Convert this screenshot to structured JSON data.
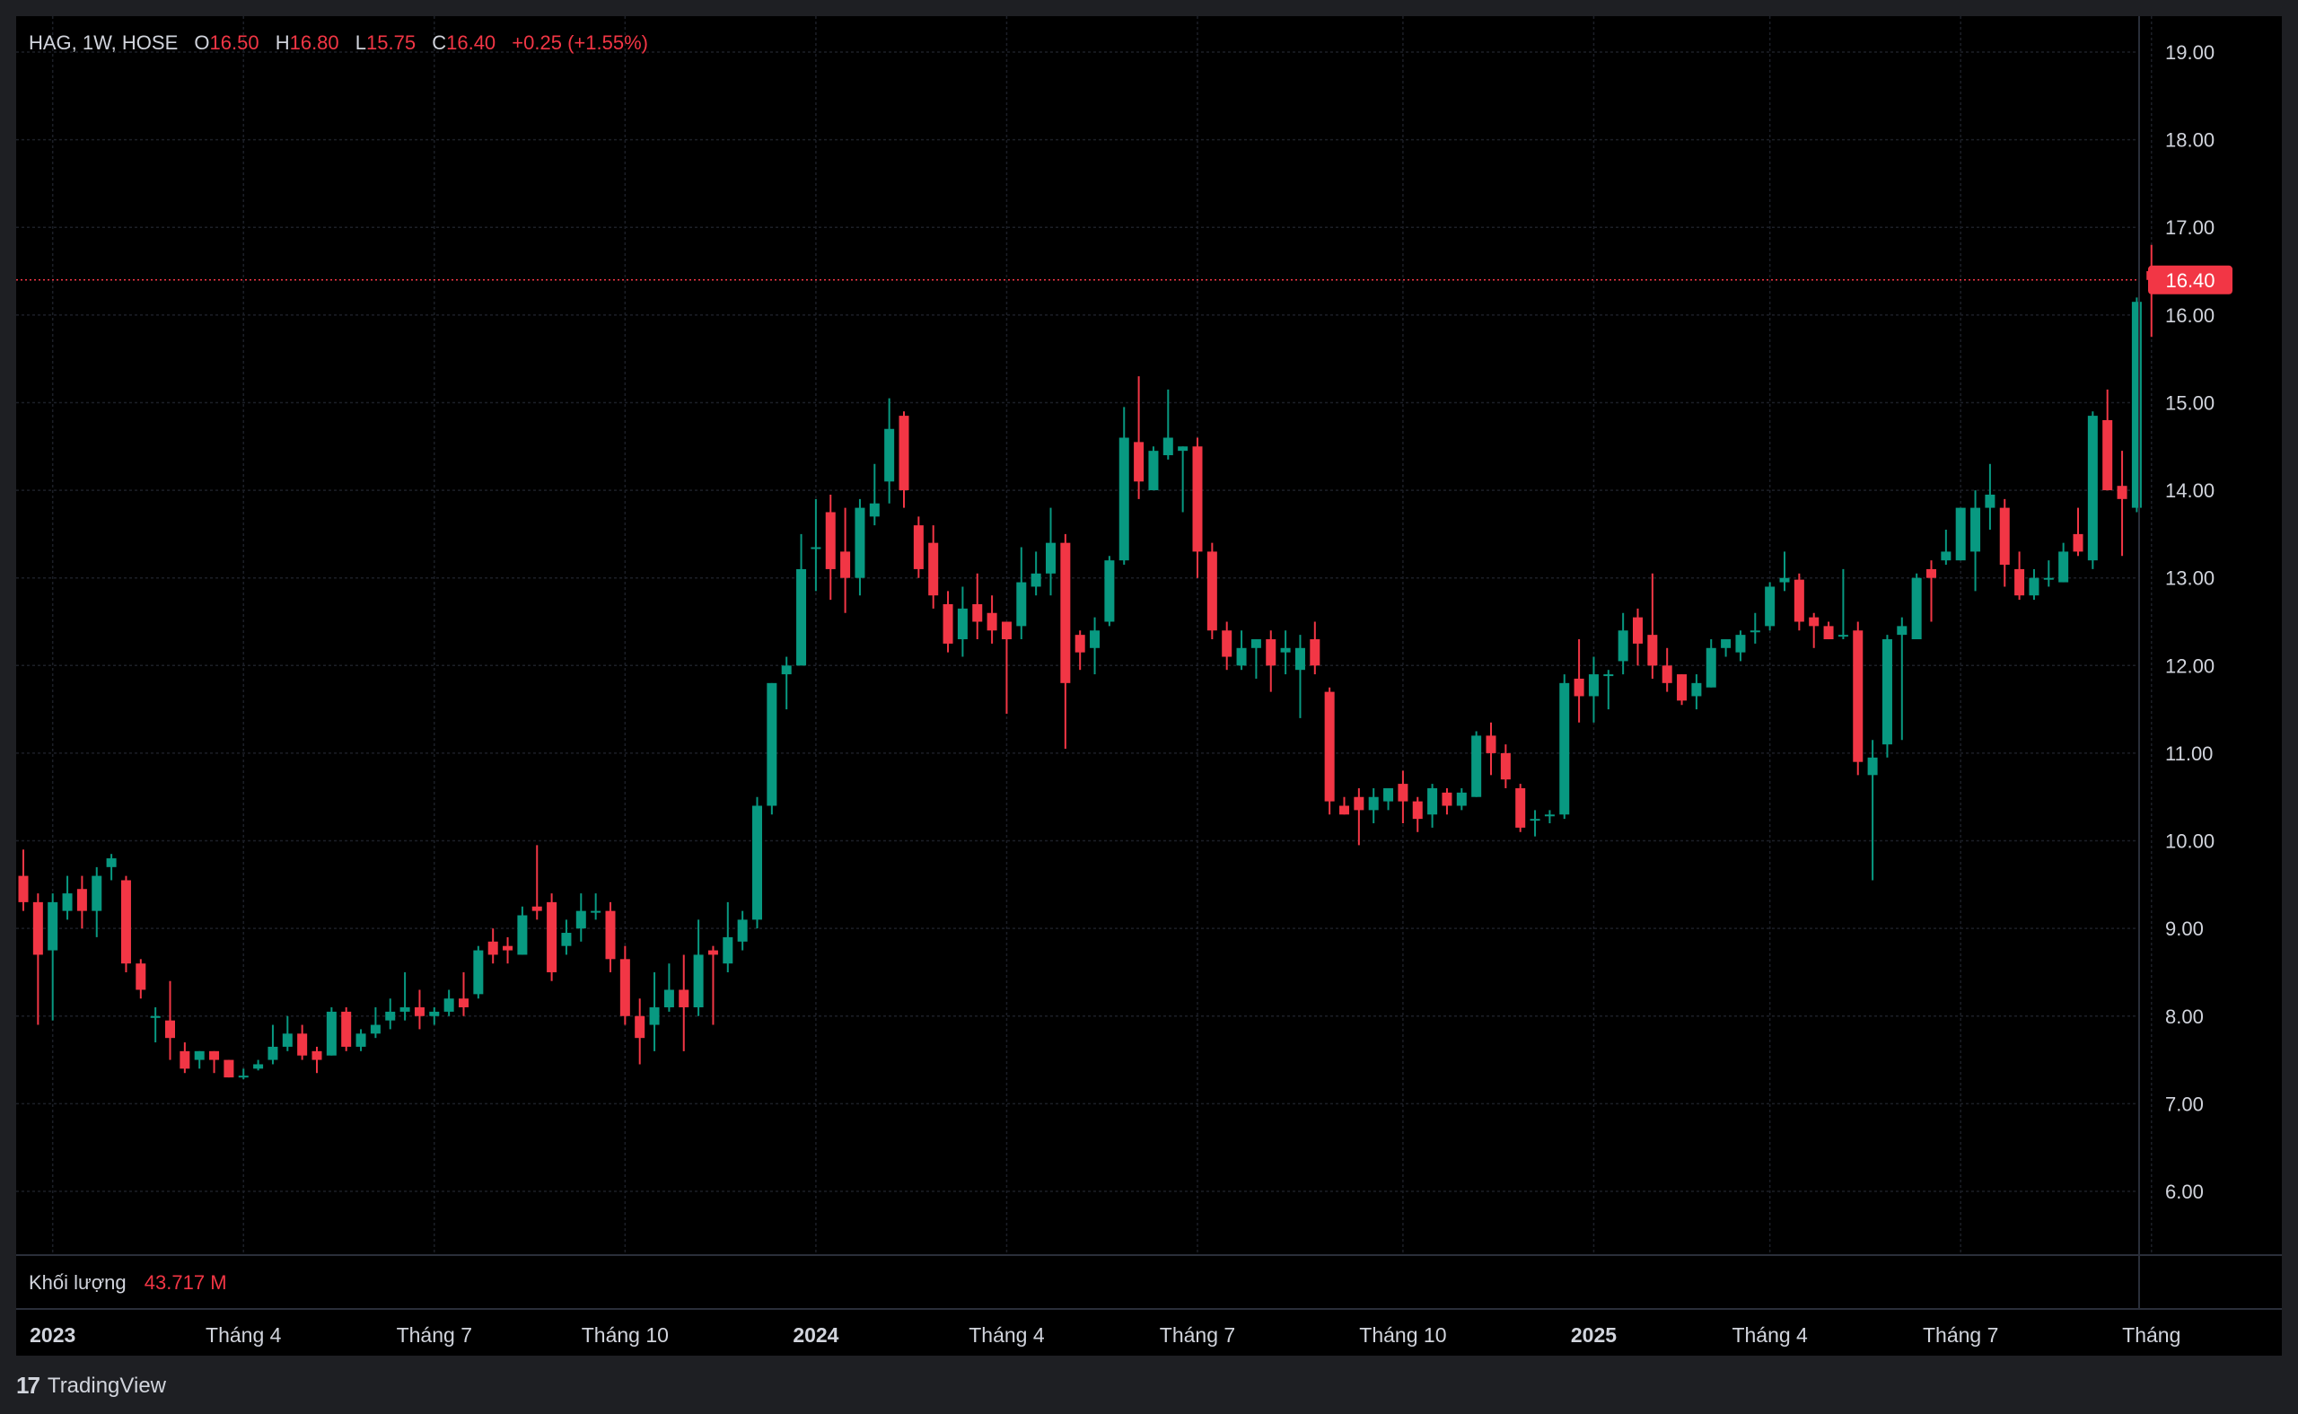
{
  "legend": {
    "symbol": "HAG, 1W, HOSE",
    "o_label": "O",
    "o_value": "16.50",
    "h_label": "H",
    "h_value": "16.80",
    "l_label": "L",
    "l_value": "15.75",
    "c_label": "C",
    "c_value": "16.40",
    "change": "+0.25 (+1.55%)"
  },
  "volume_legend": {
    "label": "Khối lượng",
    "value": "43.717 M"
  },
  "last_price_label": "16.40",
  "brand": {
    "logo": "17",
    "name": "TradingView"
  },
  "colors": {
    "up": "#089981",
    "down": "#f23645",
    "background": "#000000",
    "frame": "#1e1f23",
    "text": "#d1d4dc",
    "grid": "#2a2e39"
  },
  "chart_data": {
    "type": "candlestick",
    "interval": "1W",
    "ylim": [
      5.3,
      19.4
    ],
    "yticks": [
      "19.00",
      "18.00",
      "17.00",
      "16.00",
      "15.00",
      "14.00",
      "13.00",
      "12.00",
      "11.00",
      "10.00",
      "9.00",
      "8.00",
      "7.00",
      "6.00"
    ],
    "xticks": [
      {
        "label": "2023",
        "bold": true,
        "week": 2
      },
      {
        "label": "Tháng 4",
        "bold": false,
        "week": 15
      },
      {
        "label": "Tháng 7",
        "bold": false,
        "week": 28
      },
      {
        "label": "Tháng 10",
        "bold": false,
        "week": 41
      },
      {
        "label": "2024",
        "bold": true,
        "week": 54
      },
      {
        "label": "Tháng 4",
        "bold": false,
        "week": 67
      },
      {
        "label": "Tháng 7",
        "bold": false,
        "week": 80
      },
      {
        "label": "Tháng 10",
        "bold": false,
        "week": 94
      },
      {
        "label": "2025",
        "bold": true,
        "week": 107
      },
      {
        "label": "Tháng 4",
        "bold": false,
        "week": 119
      },
      {
        "label": "Tháng 7",
        "bold": false,
        "week": 132
      },
      {
        "label": "Tháng",
        "bold": false,
        "week": 145
      }
    ],
    "last_price": 16.4,
    "candles": [
      [
        9.6,
        9.3,
        9.9,
        9.2
      ],
      [
        9.3,
        8.7,
        9.4,
        7.9
      ],
      [
        8.75,
        9.3,
        9.4,
        7.95
      ],
      [
        9.2,
        9.4,
        9.6,
        9.1
      ],
      [
        9.45,
        9.2,
        9.6,
        9.0
      ],
      [
        9.2,
        9.6,
        9.7,
        8.9
      ],
      [
        9.7,
        9.8,
        9.85,
        9.55
      ],
      [
        9.55,
        8.6,
        9.6,
        8.5
      ],
      [
        8.6,
        8.3,
        8.65,
        8.2
      ],
      [
        8.0,
        8.0,
        8.1,
        7.7
      ],
      [
        7.95,
        7.75,
        8.4,
        7.5
      ],
      [
        7.6,
        7.4,
        7.7,
        7.35
      ],
      [
        7.5,
        7.6,
        7.6,
        7.4
      ],
      [
        7.6,
        7.5,
        7.6,
        7.35
      ],
      [
        7.5,
        7.3,
        7.5,
        7.3
      ],
      [
        7.32,
        7.32,
        7.4,
        7.28
      ],
      [
        7.4,
        7.45,
        7.5,
        7.38
      ],
      [
        7.5,
        7.65,
        7.9,
        7.45
      ],
      [
        7.65,
        7.8,
        8.0,
        7.6
      ],
      [
        7.8,
        7.55,
        7.9,
        7.5
      ],
      [
        7.6,
        7.5,
        7.65,
        7.35
      ],
      [
        7.55,
        8.05,
        8.1,
        7.55
      ],
      [
        8.05,
        7.65,
        8.1,
        7.6
      ],
      [
        7.65,
        7.8,
        7.85,
        7.6
      ],
      [
        7.8,
        7.9,
        8.1,
        7.75
      ],
      [
        7.95,
        8.05,
        8.2,
        7.85
      ],
      [
        8.05,
        8.1,
        8.5,
        7.95
      ],
      [
        8.1,
        8.0,
        8.3,
        7.85
      ],
      [
        8.0,
        8.05,
        8.1,
        7.9
      ],
      [
        8.05,
        8.2,
        8.3,
        8.0
      ],
      [
        8.2,
        8.1,
        8.5,
        8.0
      ],
      [
        8.25,
        8.75,
        8.8,
        8.2
      ],
      [
        8.85,
        8.7,
        9.0,
        8.6
      ],
      [
        8.8,
        8.75,
        8.9,
        8.6
      ],
      [
        8.7,
        9.15,
        9.25,
        8.7
      ],
      [
        9.25,
        9.2,
        9.95,
        9.1
      ],
      [
        9.3,
        8.5,
        9.4,
        8.4
      ],
      [
        8.8,
        8.95,
        9.1,
        8.7
      ],
      [
        9.0,
        9.2,
        9.4,
        8.85
      ],
      [
        9.2,
        9.2,
        9.4,
        9.1
      ],
      [
        9.2,
        8.65,
        9.3,
        8.5
      ],
      [
        8.65,
        8.0,
        8.8,
        7.9
      ],
      [
        8.0,
        7.75,
        8.2,
        7.45
      ],
      [
        7.9,
        8.1,
        8.5,
        7.6
      ],
      [
        8.1,
        8.3,
        8.6,
        8.05
      ],
      [
        8.3,
        8.1,
        8.7,
        7.6
      ],
      [
        8.1,
        8.7,
        9.1,
        8.0
      ],
      [
        8.75,
        8.7,
        8.8,
        7.9
      ],
      [
        8.6,
        8.9,
        9.3,
        8.5
      ],
      [
        8.85,
        9.1,
        9.2,
        8.75
      ],
      [
        9.1,
        10.4,
        10.5,
        9.0
      ],
      [
        10.4,
        11.8,
        11.8,
        10.3
      ],
      [
        11.9,
        12.0,
        12.1,
        11.5
      ],
      [
        12.0,
        13.1,
        13.5,
        12.0
      ],
      [
        13.35,
        13.35,
        13.9,
        12.85
      ],
      [
        13.75,
        13.1,
        13.95,
        12.75
      ],
      [
        13.3,
        13.0,
        13.8,
        12.6
      ],
      [
        13.0,
        13.8,
        13.9,
        12.8
      ],
      [
        13.7,
        13.85,
        14.3,
        13.6
      ],
      [
        14.1,
        14.7,
        15.05,
        13.85
      ],
      [
        14.85,
        14.0,
        14.9,
        13.8
      ],
      [
        13.6,
        13.1,
        13.7,
        13.0
      ],
      [
        13.4,
        12.8,
        13.6,
        12.65
      ],
      [
        12.7,
        12.25,
        12.85,
        12.15
      ],
      [
        12.3,
        12.65,
        12.9,
        12.1
      ],
      [
        12.7,
        12.5,
        13.05,
        12.3
      ],
      [
        12.6,
        12.4,
        12.8,
        12.25
      ],
      [
        12.5,
        12.3,
        12.5,
        11.45
      ],
      [
        12.45,
        12.95,
        13.35,
        12.3
      ],
      [
        12.9,
        13.05,
        13.3,
        12.8
      ],
      [
        13.05,
        13.4,
        13.8,
        12.8
      ],
      [
        13.4,
        11.8,
        13.5,
        11.05
      ],
      [
        12.35,
        12.15,
        12.4,
        11.95
      ],
      [
        12.2,
        12.4,
        12.55,
        11.9
      ],
      [
        12.5,
        13.2,
        13.25,
        12.45
      ],
      [
        13.2,
        14.6,
        14.95,
        13.15
      ],
      [
        14.55,
        14.1,
        15.3,
        13.9
      ],
      [
        14.0,
        14.45,
        14.5,
        14.0
      ],
      [
        14.4,
        14.6,
        15.15,
        14.35
      ],
      [
        14.45,
        14.5,
        14.5,
        13.75
      ],
      [
        14.5,
        13.3,
        14.6,
        13.0
      ],
      [
        13.3,
        12.4,
        13.4,
        12.3
      ],
      [
        12.4,
        12.1,
        12.5,
        11.95
      ],
      [
        12.0,
        12.2,
        12.4,
        11.95
      ],
      [
        12.2,
        12.3,
        12.3,
        11.85
      ],
      [
        12.3,
        12.0,
        12.4,
        11.7
      ],
      [
        12.15,
        12.2,
        12.4,
        11.9
      ],
      [
        11.95,
        12.2,
        12.35,
        11.4
      ],
      [
        12.3,
        12.0,
        12.5,
        11.9
      ],
      [
        11.7,
        10.45,
        11.75,
        10.3
      ],
      [
        10.4,
        10.3,
        10.5,
        10.3
      ],
      [
        10.5,
        10.35,
        10.6,
        9.95
      ],
      [
        10.35,
        10.5,
        10.6,
        10.2
      ],
      [
        10.45,
        10.6,
        10.55,
        10.35
      ],
      [
        10.65,
        10.45,
        10.8,
        10.2
      ],
      [
        10.45,
        10.25,
        10.5,
        10.1
      ],
      [
        10.3,
        10.6,
        10.65,
        10.15
      ],
      [
        10.55,
        10.4,
        10.6,
        10.3
      ],
      [
        10.4,
        10.55,
        10.6,
        10.35
      ],
      [
        10.5,
        11.2,
        11.25,
        10.5
      ],
      [
        11.2,
        11.0,
        11.35,
        10.75
      ],
      [
        11.0,
        10.7,
        11.1,
        10.6
      ],
      [
        10.6,
        10.15,
        10.65,
        10.1
      ],
      [
        10.25,
        10.25,
        10.35,
        10.05
      ],
      [
        10.3,
        10.3,
        10.35,
        10.2
      ],
      [
        10.3,
        11.8,
        11.9,
        10.25
      ],
      [
        11.85,
        11.65,
        12.3,
        11.35
      ],
      [
        11.65,
        11.9,
        12.1,
        11.35
      ],
      [
        11.9,
        11.9,
        11.95,
        11.5
      ],
      [
        12.05,
        12.4,
        12.6,
        11.9
      ],
      [
        12.55,
        12.25,
        12.65,
        12.0
      ],
      [
        12.35,
        12.0,
        13.05,
        11.85
      ],
      [
        12.0,
        11.8,
        12.2,
        11.7
      ],
      [
        11.9,
        11.6,
        11.9,
        11.55
      ],
      [
        11.65,
        11.8,
        11.9,
        11.5
      ],
      [
        11.75,
        12.2,
        12.3,
        11.75
      ],
      [
        12.2,
        12.3,
        12.3,
        12.1
      ],
      [
        12.15,
        12.35,
        12.4,
        12.05
      ],
      [
        12.4,
        12.4,
        12.6,
        12.25
      ],
      [
        12.45,
        12.9,
        12.95,
        12.4
      ],
      [
        12.95,
        13.0,
        13.3,
        12.85
      ],
      [
        12.98,
        12.5,
        13.05,
        12.4
      ],
      [
        12.55,
        12.45,
        12.6,
        12.2
      ],
      [
        12.45,
        12.3,
        12.5,
        12.3
      ],
      [
        12.35,
        12.35,
        13.1,
        12.3
      ],
      [
        12.4,
        10.9,
        12.5,
        10.75
      ],
      [
        10.75,
        10.95,
        11.15,
        9.55
      ],
      [
        11.1,
        12.3,
        12.35,
        10.95
      ],
      [
        12.35,
        12.45,
        12.55,
        11.15
      ],
      [
        12.3,
        13.0,
        13.05,
        12.3
      ],
      [
        13.1,
        13.0,
        13.2,
        12.5
      ],
      [
        13.2,
        13.3,
        13.55,
        13.15
      ],
      [
        13.2,
        13.8,
        13.8,
        13.2
      ],
      [
        13.3,
        13.8,
        14.0,
        12.85
      ],
      [
        13.8,
        13.95,
        14.3,
        13.55
      ],
      [
        13.8,
        13.15,
        13.9,
        12.9
      ],
      [
        13.1,
        12.8,
        13.3,
        12.75
      ],
      [
        12.8,
        13.0,
        13.1,
        12.75
      ],
      [
        13.0,
        13.0,
        13.2,
        12.9
      ],
      [
        12.95,
        13.3,
        13.4,
        12.95
      ],
      [
        13.5,
        13.3,
        13.8,
        13.25
      ],
      [
        13.2,
        14.85,
        14.9,
        13.1
      ],
      [
        14.8,
        14.0,
        15.15,
        14.0
      ],
      [
        14.05,
        13.9,
        14.45,
        13.25
      ],
      [
        13.8,
        16.15,
        16.2,
        13.75
      ],
      [
        16.5,
        16.4,
        16.8,
        15.75
      ]
    ]
  }
}
